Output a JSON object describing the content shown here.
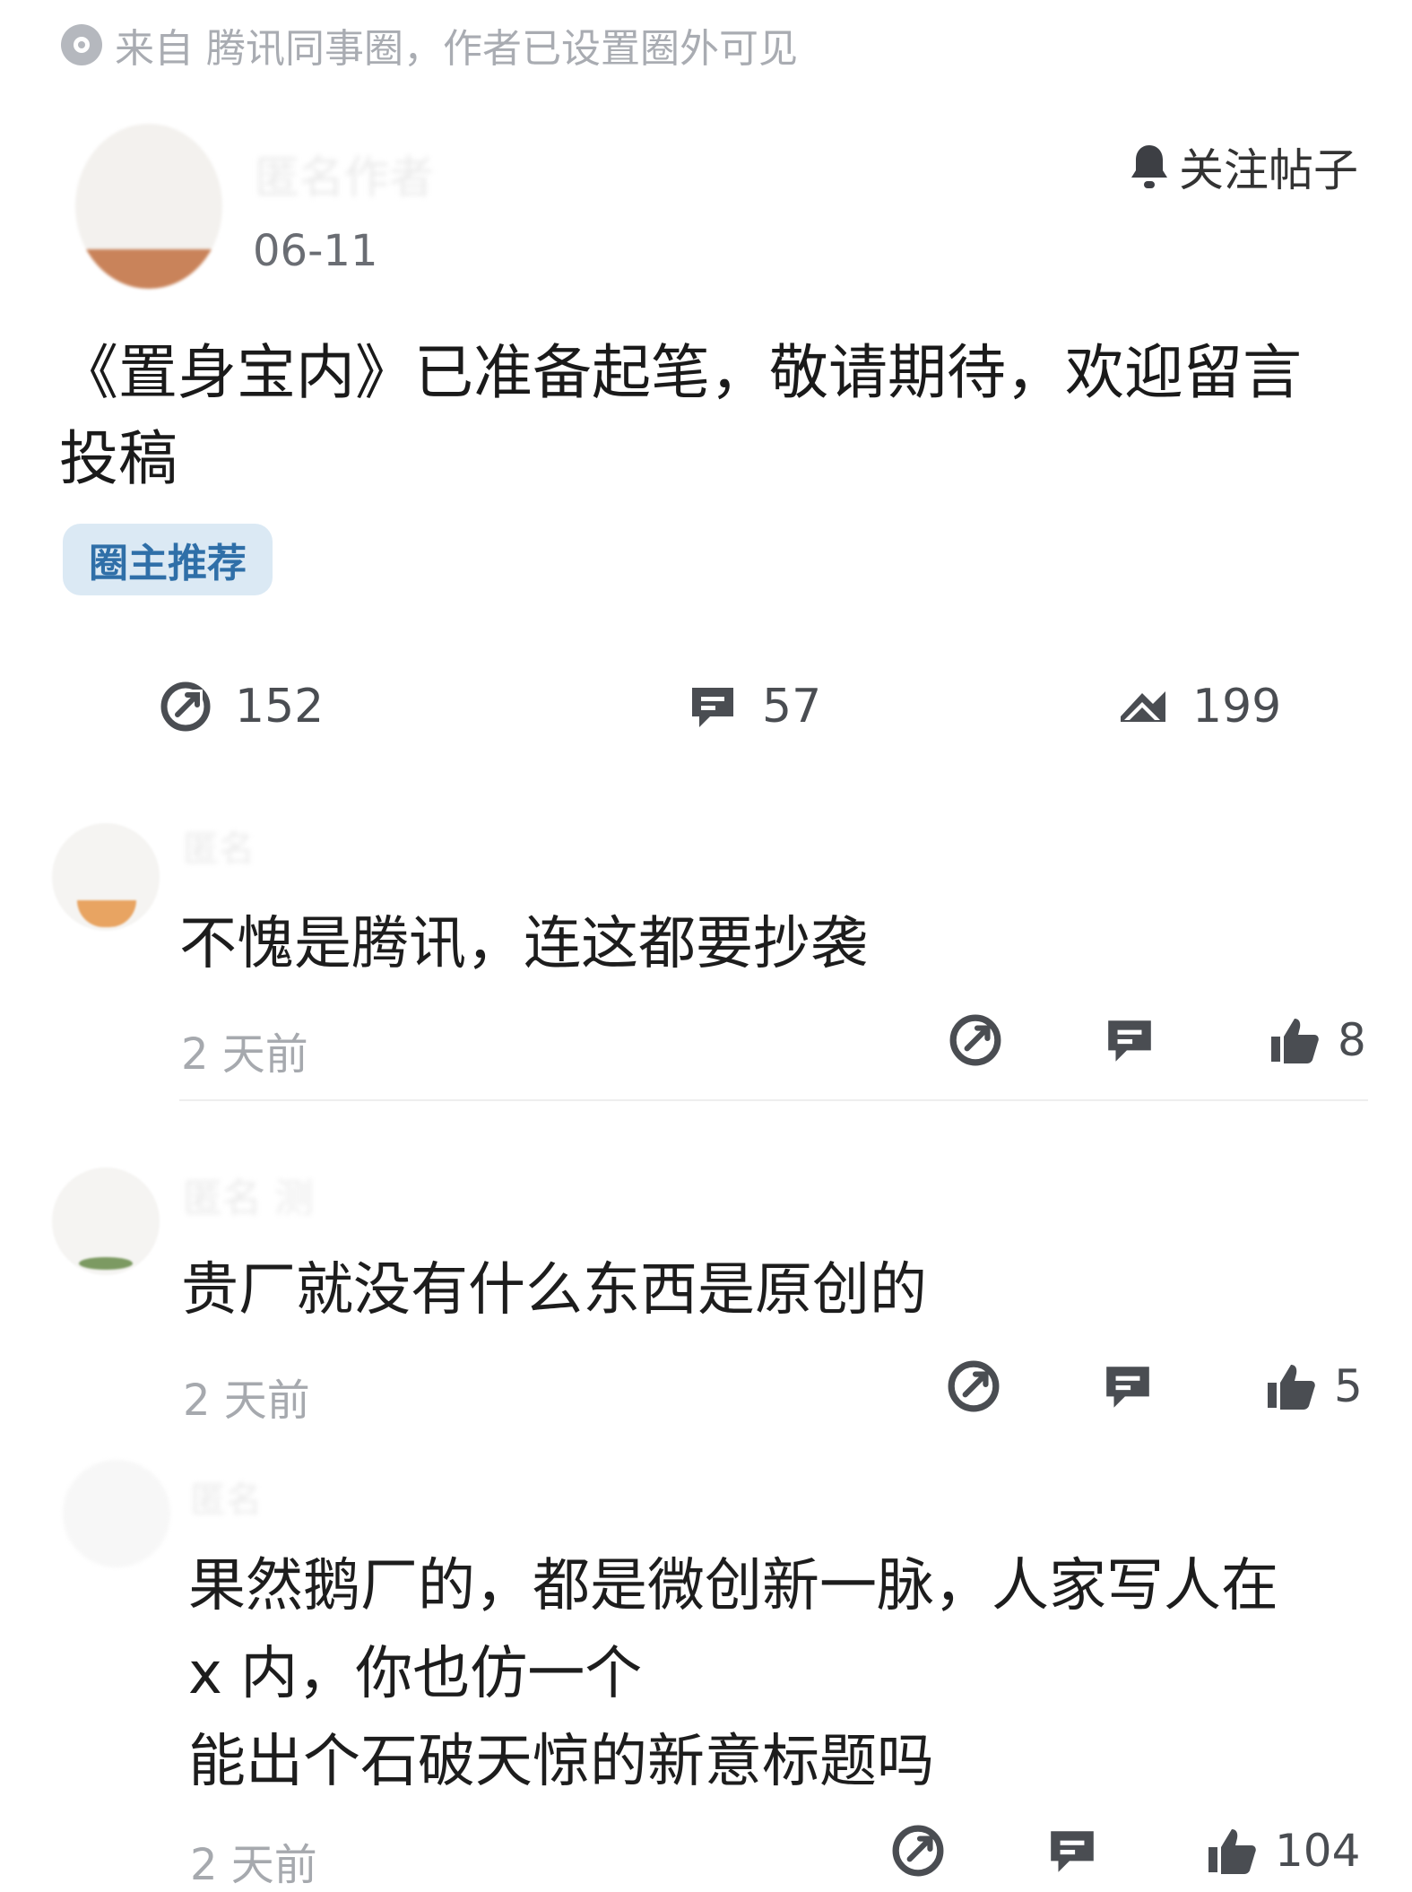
{
  "source": {
    "text": "来自 腾讯同事圈，作者已设置圈外可见"
  },
  "post": {
    "author_name": "匿名作者",
    "date": "06-11",
    "follow_label": "关注帖子",
    "body": "《置身宝内》已准备起笔，敬请期待，欢迎留言投稿",
    "tag": "圈主推荐",
    "stats": {
      "shares": "152",
      "comments": "57",
      "reactions": "199"
    }
  },
  "comments": [
    {
      "name": "匿名",
      "text": "不愧是腾讯，连这都要抄袭",
      "time": "2 天前",
      "likes": "8"
    },
    {
      "name": "匿名 测",
      "text": "贵厂就没有什么东西是原创的",
      "time": "2 天前",
      "likes": "5"
    },
    {
      "name": "匿名",
      "text_lines": [
        "果然鹅厂的，都是微创新一脉，人家写人在",
        "x 内，你也仿一个",
        "能出个石破天惊的新意标题吗"
      ],
      "time": "2 天前",
      "likes": "104"
    }
  ],
  "icons": {
    "share": "share-arrow-icon",
    "comment": "comment-icon",
    "reaction": "reaction-icon",
    "like": "thumbs-up-icon",
    "bell": "bell-icon"
  },
  "colors": {
    "tag_bg": "#dbe9f4",
    "tag_text": "#2f6fa8",
    "muted": "#a6a9ae",
    "icon": "#4a4d52"
  }
}
